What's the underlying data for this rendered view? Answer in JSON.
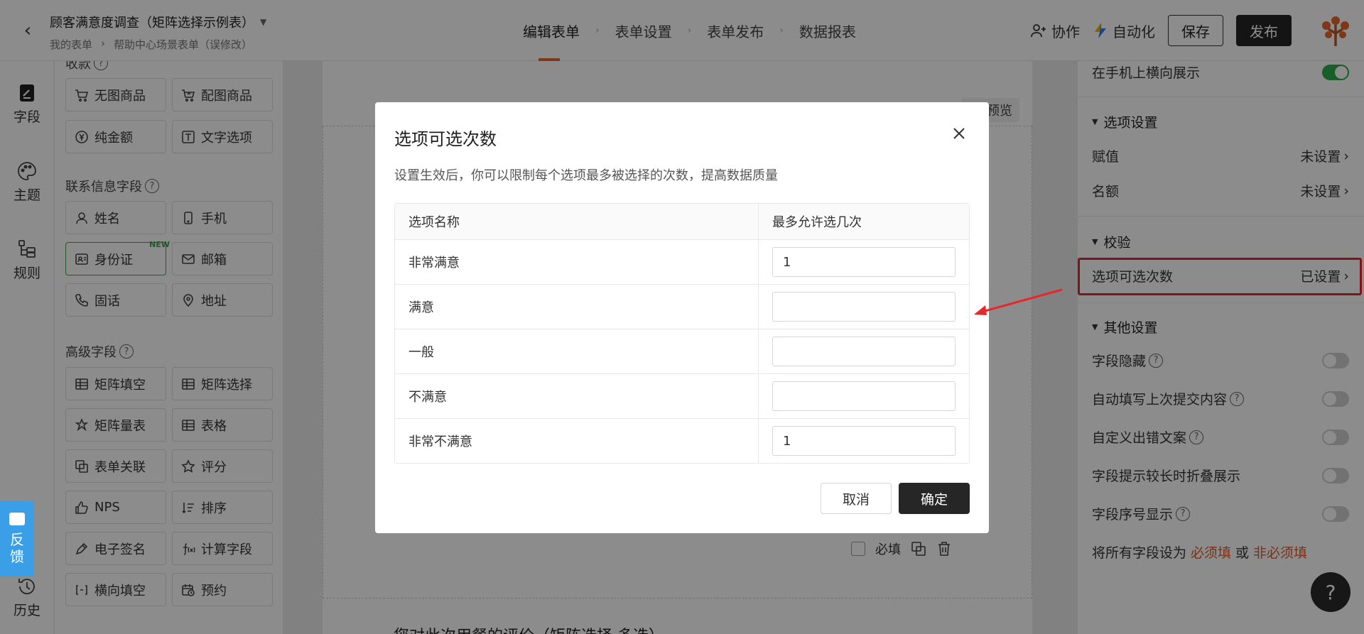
{
  "header": {
    "form_title": "顾客满意度调查（矩阵选择示例表）",
    "breadcrumb": [
      "我的表单",
      "帮助中心场景表单（误修改）"
    ],
    "steps": [
      "编辑表单",
      "表单设置",
      "表单发布",
      "数据报表"
    ],
    "active_step": 0,
    "collab_label": "协作",
    "automation_label": "自动化",
    "save_label": "保存",
    "publish_label": "发布"
  },
  "left_nav": {
    "items": [
      {
        "label": "字段",
        "icon": "edit-doc-icon"
      },
      {
        "label": "主题",
        "icon": "palette-icon"
      },
      {
        "label": "规则",
        "icon": "rules-icon"
      },
      {
        "label": "历史",
        "icon": "history-icon"
      }
    ]
  },
  "field_panel": {
    "partial_group_title": "收款",
    "row0": [
      "无图商品",
      "配图商品"
    ],
    "row1": [
      "纯金额",
      "文字选项"
    ],
    "contact_title": "联系信息字段",
    "contact": [
      "姓名",
      "手机",
      "身份证",
      "邮箱",
      "固话",
      "地址"
    ],
    "new_badge": "NEW",
    "advanced_title": "高级字段",
    "advanced": [
      "矩阵填空",
      "矩阵选择",
      "矩阵量表",
      "表格",
      "表单关联",
      "评分",
      "NPS",
      "排序",
      "电子签名",
      "计算字段",
      "横向填空",
      "预约"
    ]
  },
  "canvas": {
    "preview_label": "预览",
    "required_label": "必填",
    "next_question": "您对此次用餐的评价（矩阵选择 多选）"
  },
  "right_panel": {
    "landscape_label": "在手机上横向展示",
    "landscape_on": true,
    "option_settings_title": "选项设置",
    "assign_label": "赋值",
    "assign_value": "未设置",
    "quota_label": "名额",
    "quota_value": "未设置",
    "validation_title": "校验",
    "option_limit_label": "选项可选次数",
    "option_limit_value": "已设置",
    "other_title": "其他设置",
    "toggles": [
      {
        "label": "字段隐藏",
        "help": true
      },
      {
        "label": "自动填写上次提交内容",
        "help": true
      },
      {
        "label": "自定义出错文案",
        "help": true
      },
      {
        "label": "字段提示较长时折叠展示",
        "help": false
      },
      {
        "label": "字段序号显示",
        "help": true
      }
    ],
    "bulk_prefix": "将所有字段设为",
    "bulk_required": "必须填",
    "bulk_or": "或",
    "bulk_optional": "非必须填",
    "help_fab": "?"
  },
  "feedback": {
    "label_1": "反",
    "label_2": "馈"
  },
  "modal": {
    "title": "选项可选次数",
    "description": "设置生效后，你可以限制每个选项最多被选择的次数，提高数据质量",
    "col_name": "选项名称",
    "col_limit": "最多允许选几次",
    "rows": [
      {
        "name": "非常满意",
        "limit": "1"
      },
      {
        "name": "满意",
        "limit": ""
      },
      {
        "name": "一般",
        "limit": ""
      },
      {
        "name": "不满意",
        "limit": ""
      },
      {
        "name": "非常不满意",
        "limit": "1"
      }
    ],
    "cancel_label": "取消",
    "confirm_label": "确定"
  },
  "colors": {
    "accent": "#e8672b",
    "primary_dark": "#262626",
    "toggle_on": "#2eaa4a",
    "highlight_red": "#e8272b",
    "feedback_blue": "#3b9fe8"
  }
}
